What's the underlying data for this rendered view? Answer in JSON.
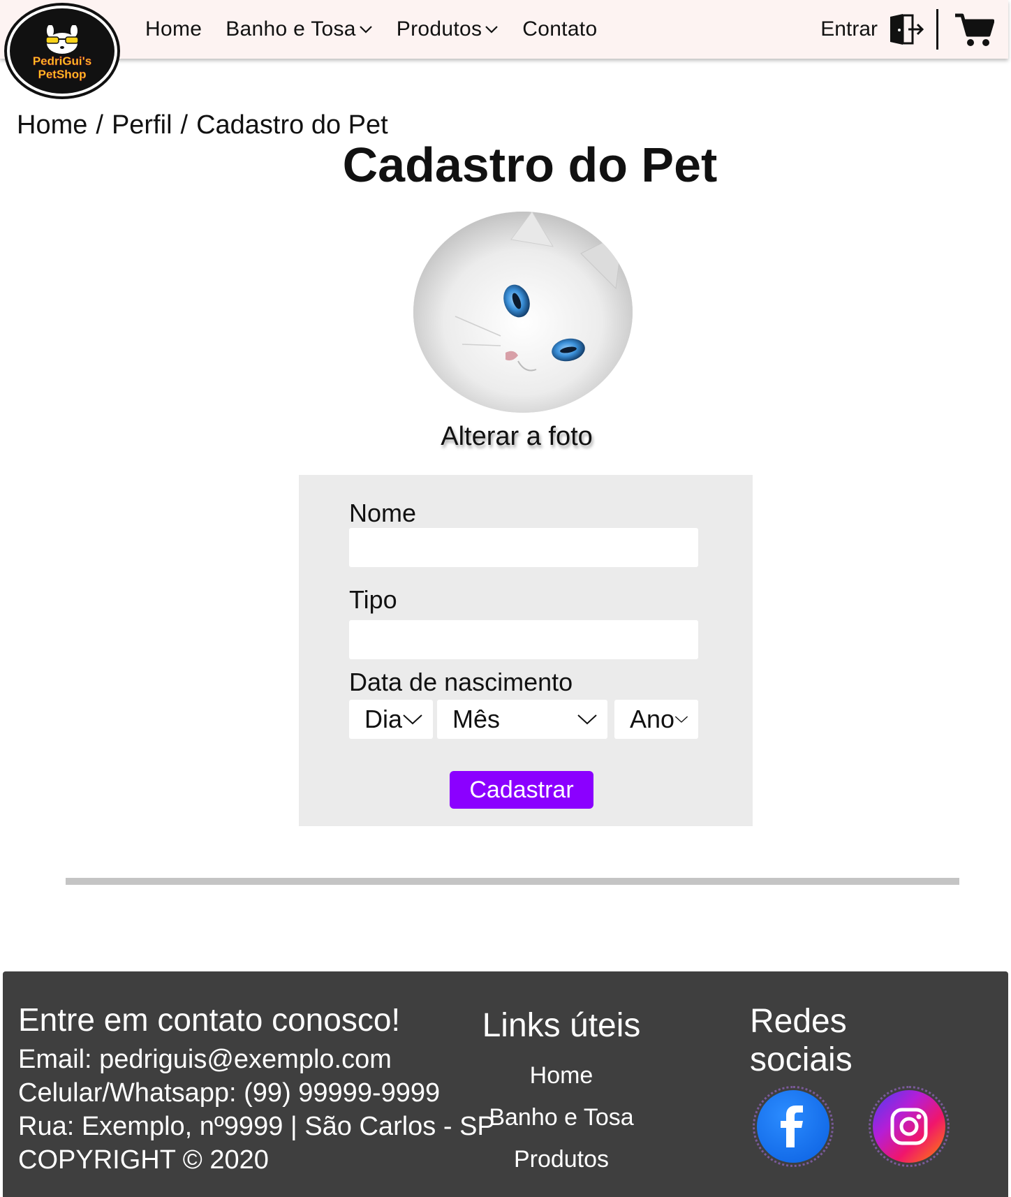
{
  "brand": {
    "logo_line1": "PedriGui's",
    "logo_line2": "PetShop"
  },
  "nav": {
    "home": "Home",
    "banho_tosa": "Banho e Tosa",
    "produtos": "Produtos",
    "contato": "Contato",
    "entrar": "Entrar"
  },
  "breadcrumb": {
    "home": "Home",
    "perfil": "Perfil",
    "current": "Cadastro do Pet",
    "separator": "/"
  },
  "page": {
    "title": "Cadastro do Pet",
    "change_photo": "Alterar a foto"
  },
  "form": {
    "nome_label": "Nome",
    "nome_value": "",
    "tipo_label": "Tipo",
    "tipo_value": "",
    "data_label": "Data de nascimento",
    "dia_selected": "Dia",
    "mes_selected": "Mês",
    "ano_selected": "Ano",
    "submit_label": "Cadastrar"
  },
  "footer": {
    "contact_title": "Entre em contato conosco!",
    "email": "Email: pedriguis@exemplo.com",
    "phone": "Celular/Whatsapp: (99) 99999-9999",
    "address": "Rua: Exemplo, nº9999 | São Carlos - SP",
    "copyright": "COPYRIGHT © 2020",
    "links_title": "Links úteis",
    "links": [
      "Home",
      "Banho e Tosa",
      "Produtos"
    ],
    "social_title": "Redes sociais"
  },
  "colors": {
    "navbar_bg": "#fdf3f2",
    "form_bg": "#ebebeb",
    "button_bg": "#8b00ff",
    "footer_bg": "#3f3f3f",
    "facebook_blue": "#1877f2"
  },
  "icons": [
    "dog-logo-icon",
    "chevron-down-icon",
    "door-exit-icon",
    "cart-icon",
    "facebook-icon",
    "instagram-icon"
  ]
}
